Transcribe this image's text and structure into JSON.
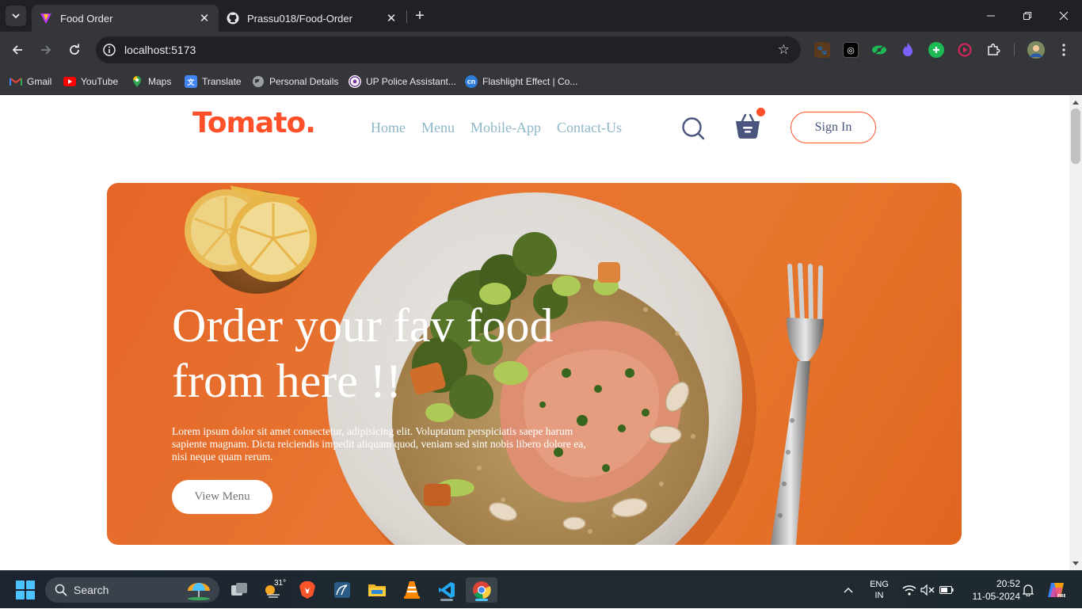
{
  "browser": {
    "tabs": [
      {
        "title": "Food Order",
        "active": true,
        "icon": "vite-icon"
      },
      {
        "title": "Prassu018/Food-Order",
        "active": false,
        "icon": "github-icon"
      }
    ],
    "close_glyph": "✕",
    "new_tab_glyph": "+",
    "url": "localhost:5173",
    "bookmarks": [
      {
        "label": "Gmail",
        "icon": "gmail-icon"
      },
      {
        "label": "YouTube",
        "icon": "youtube-icon"
      },
      {
        "label": "Maps",
        "icon": "maps-icon"
      },
      {
        "label": "Translate",
        "icon": "translate-icon"
      },
      {
        "label": "Personal Details",
        "icon": "globe-icon"
      },
      {
        "label": "UP Police Assistant...",
        "icon": "police-icon"
      },
      {
        "label": "Flashlight Effect | Co...",
        "icon": "codepen-icon"
      }
    ]
  },
  "site": {
    "logo": "Tomato.",
    "nav": [
      "Home",
      "Menu",
      "Mobile-App",
      "Contact-Us"
    ],
    "sign_in": "Sign In",
    "accent": "#ff5029",
    "hero": {
      "title": "Order your fav food from here !!",
      "text": "Lorem ipsum dolor sit amet consectetur, adipisicing elit. Voluptatum perspiciatis saepe harum sapiente magnam. Dicta reiciendis impedit aliquam quod, veniam sed sint nobis libero dolore ea, nisi neque quam rerum.",
      "button": "View Menu"
    }
  },
  "taskbar": {
    "search_placeholder": "Search",
    "weather": "31°",
    "language": "ENG",
    "region": "IN",
    "time": "20:52",
    "date": "11-05-2024"
  }
}
